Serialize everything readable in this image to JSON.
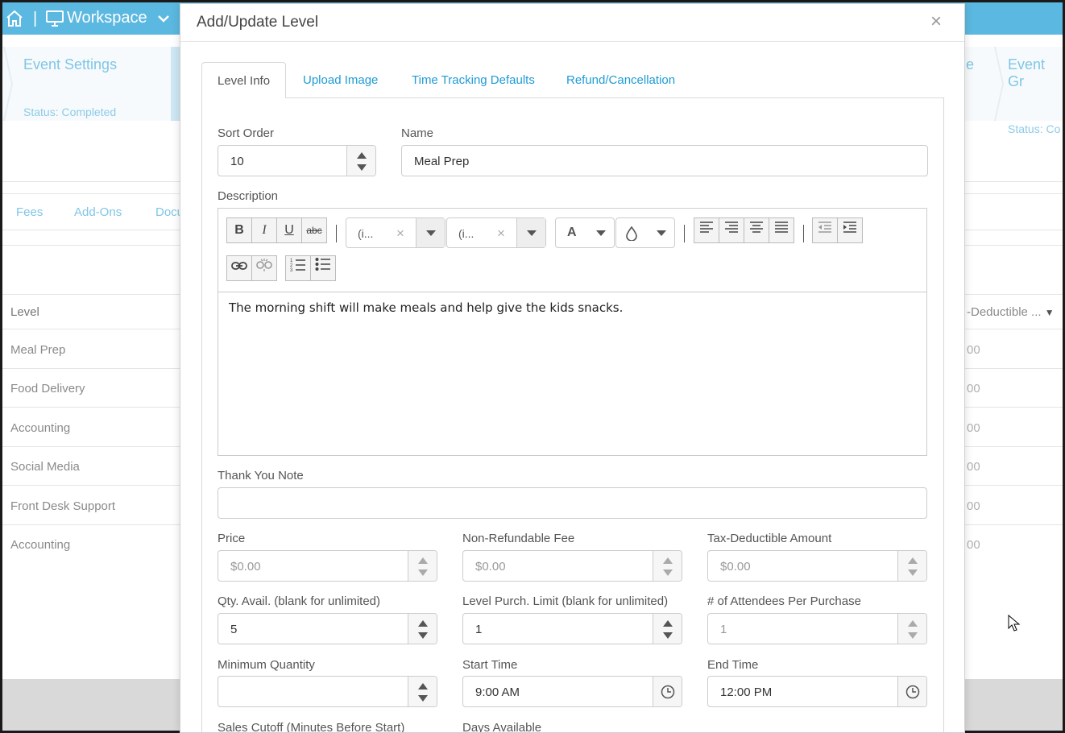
{
  "app": {
    "workspace_label": "Workspace",
    "topbar_separator": "|",
    "wizard_steps": [
      {
        "title": "Event Settings",
        "status": "Status: Completed"
      },
      {
        "title": "e",
        "status": ""
      },
      {
        "title": "Event Gr",
        "status": "Status: Co"
      }
    ],
    "subtabs": [
      "Fees",
      "Add-Ons",
      "Docu"
    ],
    "table_header": "Level",
    "right_header": "-Deductible ...",
    "rows": [
      {
        "level": "Meal Prep",
        "right": "00"
      },
      {
        "level": "Food Delivery",
        "right": "00"
      },
      {
        "level": "Accounting",
        "right": "00"
      },
      {
        "level": "Social Media",
        "right": "00"
      },
      {
        "level": "Front Desk Support",
        "right": "00"
      },
      {
        "level": "Accounting",
        "right": "00"
      }
    ]
  },
  "modal": {
    "title": "Add/Update Level",
    "close_glyph": "×",
    "tabs": [
      "Level Info",
      "Upload Image",
      "Time Tracking Defaults",
      "Refund/Cancellation"
    ],
    "active_tab": "Level Info",
    "fields": {
      "sort_order": {
        "label": "Sort Order",
        "value": "10"
      },
      "name": {
        "label": "Name",
        "value": "Meal Prep"
      },
      "description": {
        "label": "Description",
        "content": "The morning shift will make meals and help give the kids snacks.",
        "toolbar": {
          "bold": "B",
          "italic": "I",
          "underline": "U",
          "strike": "abc",
          "font_name": "(i...",
          "font_size": "(i...",
          "clear_glyph": "×",
          "font_color": "A"
        }
      },
      "thank_you_note": {
        "label": "Thank You Note",
        "value": ""
      },
      "price": {
        "label": "Price",
        "placeholder": "$0.00"
      },
      "non_refundable_fee": {
        "label": "Non-Refundable Fee",
        "placeholder": "$0.00"
      },
      "tax_deductible_amount": {
        "label": "Tax-Deductible Amount",
        "placeholder": "$0.00"
      },
      "qty_avail": {
        "label": "Qty. Avail. (blank for unlimited)",
        "value": "5"
      },
      "level_purch_limit": {
        "label": "Level Purch. Limit (blank for unlimited)",
        "value": "1"
      },
      "attendees_per_purchase": {
        "label": "# of Attendees Per Purchase",
        "value": "1"
      },
      "minimum_quantity": {
        "label": "Minimum Quantity",
        "value": ""
      },
      "start_time": {
        "label": "Start Time",
        "value": "9:00 AM"
      },
      "end_time": {
        "label": "End Time",
        "value": "12:00 PM"
      },
      "sales_cutoff": {
        "label": "Sales Cutoff (Minutes Before Start)"
      },
      "days_available": {
        "label": "Days Available"
      }
    }
  },
  "colors": {
    "topbar": "#5bb8e0",
    "link": "#1f9bd6",
    "muted_link": "#7fc6e6"
  },
  "icons": [
    "home-icon",
    "monitor-icon",
    "chevron-down-icon",
    "close-icon",
    "clock-icon",
    "link-icon",
    "unlink-icon",
    "ordered-list-icon",
    "unordered-list-icon",
    "align-left-icon",
    "align-right-icon",
    "align-center-icon",
    "align-justify-icon",
    "outdent-icon",
    "indent-icon",
    "droplet-icon",
    "mouse-cursor-icon"
  ]
}
